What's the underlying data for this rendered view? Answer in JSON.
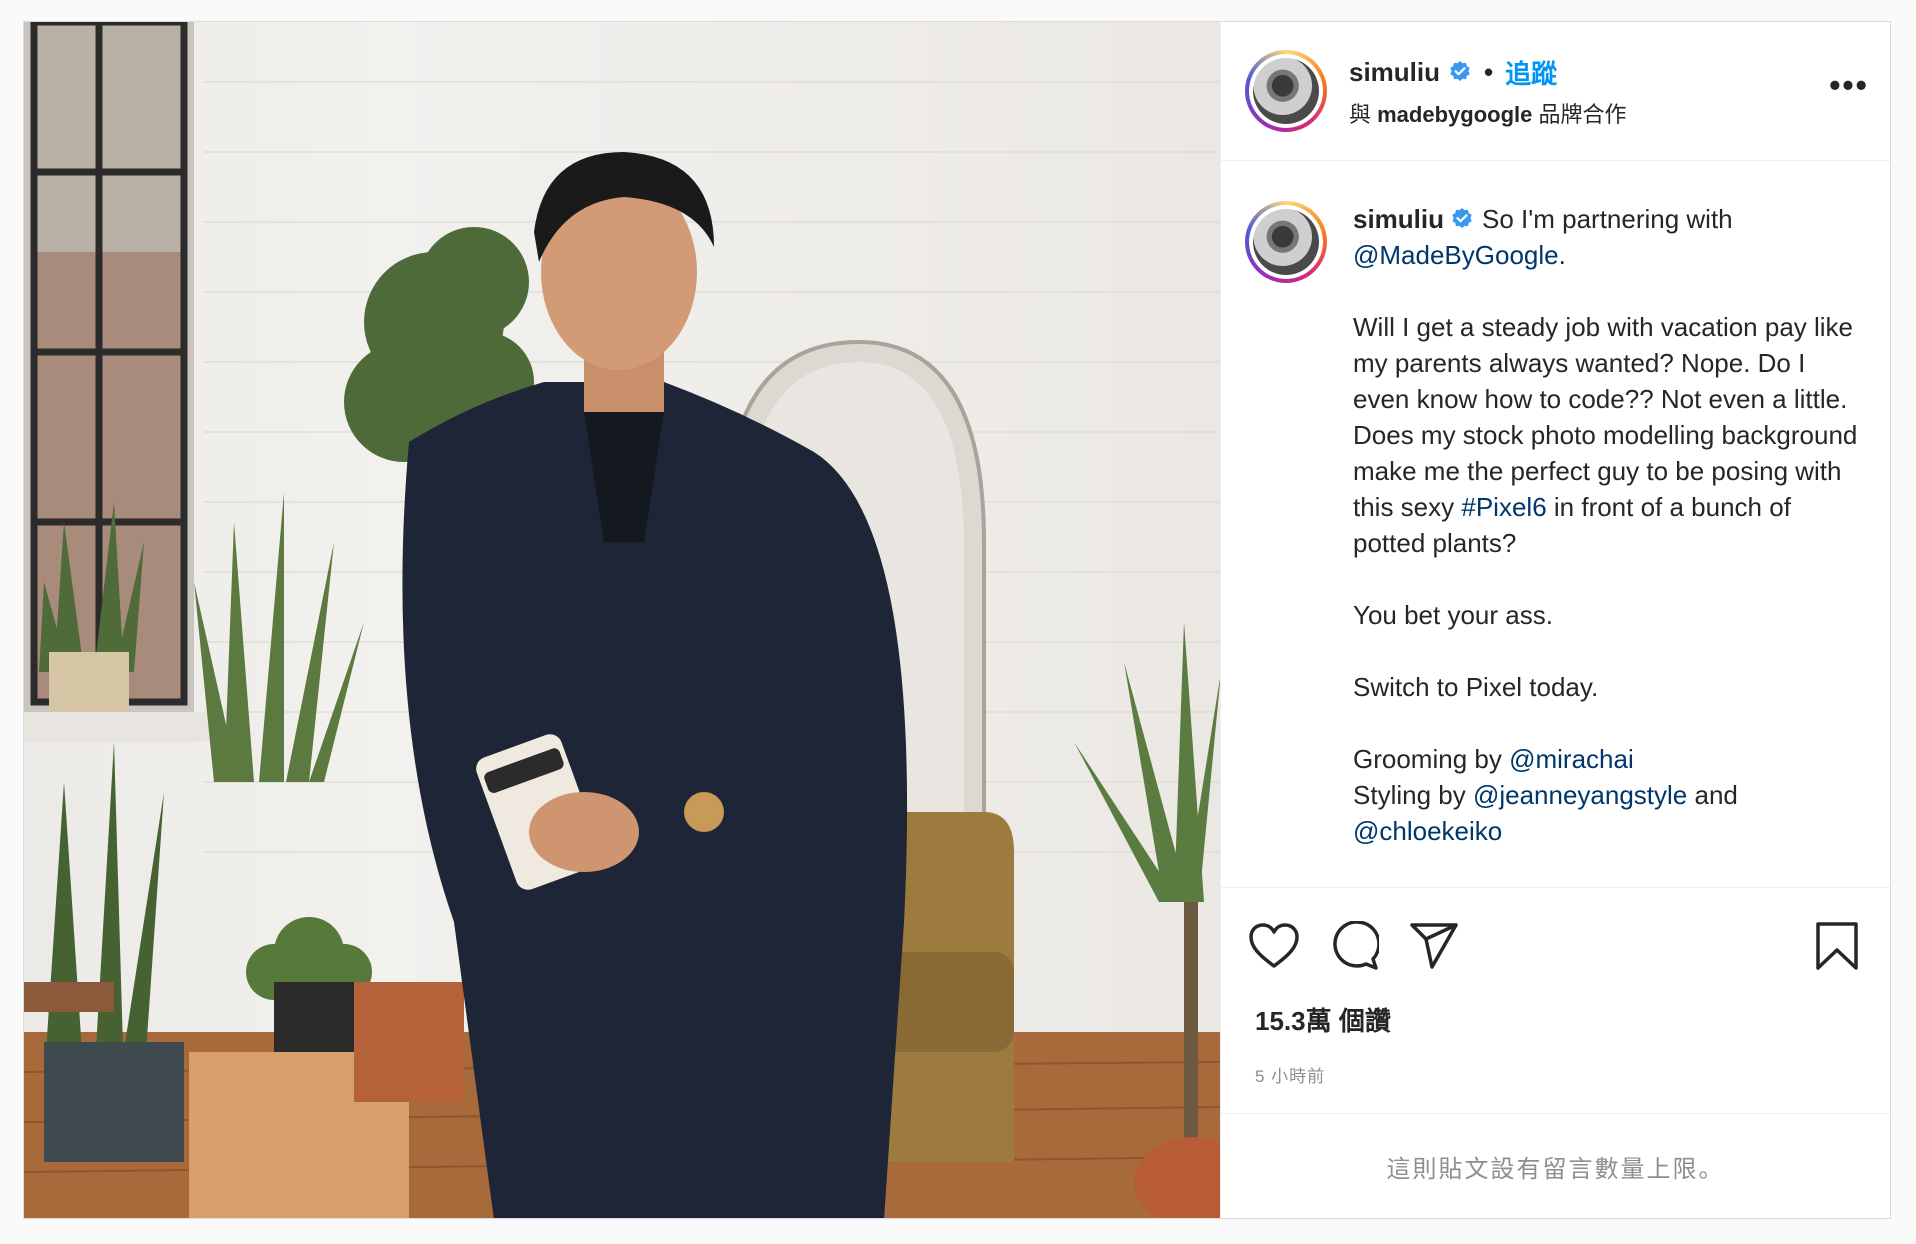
{
  "post": {
    "author": "simuliu",
    "follow_separator": "•",
    "follow_label": "追蹤",
    "partnership_prefix": "與 ",
    "partner": "madebygoogle",
    "partnership_suffix": " 品牌合作",
    "more_label": "•••"
  },
  "caption": {
    "username": "simuliu",
    "parts": [
      {
        "t": "So I'm partnering with\n"
      },
      {
        "t": "@MadeByGoogle",
        "link": true
      },
      {
        "t": ".\n\nWill I get a steady job with vacation pay like my parents always wanted? Nope. Do I even know how to code?? Not even a little. Does my stock photo modelling background make me the perfect guy to be posing with this sexy "
      },
      {
        "t": "#Pixel6",
        "link": true
      },
      {
        "t": " in front of a bunch of potted plants?\n\nYou bet your ass.\n\nSwitch to Pixel today.\n\nGrooming by "
      },
      {
        "t": "@mirachai",
        "link": true
      },
      {
        "t": "\nStyling by "
      },
      {
        "t": "@jeanneyangstyle",
        "link": true
      },
      {
        "t": " and\n"
      },
      {
        "t": "@chloekeiko",
        "link": true
      }
    ]
  },
  "actions": {
    "icons": [
      "heart-icon",
      "comment-icon",
      "share-icon",
      "bookmark-icon"
    ]
  },
  "stats": {
    "likes": "15.3萬 個讚",
    "time": "5 小時前"
  },
  "comments_off": "這則貼文設有留言數量上限。",
  "colors": {
    "follow": "#0095f6",
    "link": "#00376b",
    "verified": "#3897f0",
    "muted": "#8e8e8e"
  }
}
